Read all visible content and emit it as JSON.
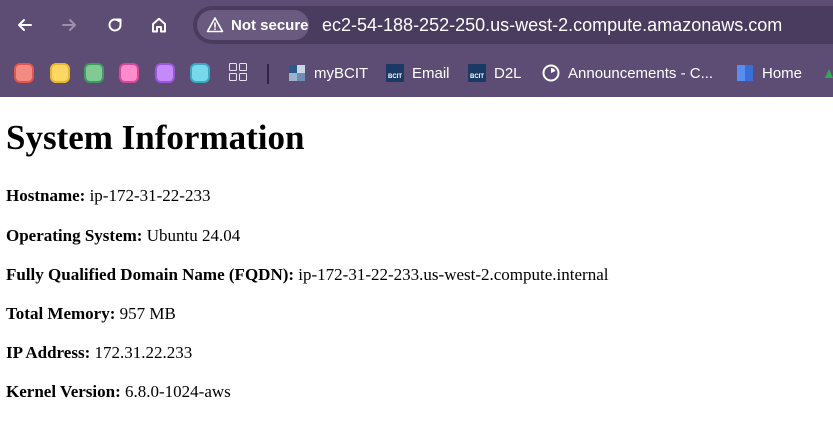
{
  "browser": {
    "security_label": "Not secure",
    "url": "ec2-54-188-252-250.us-west-2.compute.amazonaws.com",
    "color_apps": [
      {
        "fill": "#f28b82",
        "border": "#e0564f"
      },
      {
        "fill": "#fdd663",
        "border": "#e7b82e"
      },
      {
        "fill": "#81c995",
        "border": "#3f9b5f"
      },
      {
        "fill": "#ff8bcb",
        "border": "#d8489a"
      },
      {
        "fill": "#c58af9",
        "border": "#9b55e0"
      },
      {
        "fill": "#78d9ec",
        "border": "#3aa8c0"
      }
    ],
    "bookmarks": [
      {
        "label": "myBCIT",
        "icon": "mybcit-icon"
      },
      {
        "label": "Email",
        "icon": "bcit-email-icon"
      },
      {
        "label": "D2L",
        "icon": "bcit-d2l-icon"
      },
      {
        "label": "Announcements - C...",
        "icon": "announcements-icon"
      },
      {
        "label": "Home",
        "icon": "home-bookmark-icon"
      }
    ],
    "bcit_badge": "BCIT"
  },
  "page": {
    "title": "System Information",
    "fields": [
      {
        "label": "Hostname:",
        "value": "ip-172-31-22-233"
      },
      {
        "label": "Operating System:",
        "value": "Ubuntu 24.04"
      },
      {
        "label": "Fully Qualified Domain Name (FQDN):",
        "value": "ip-172-31-22-233.us-west-2.compute.internal"
      },
      {
        "label": "Total Memory:",
        "value": "957 MB"
      },
      {
        "label": "IP Address:",
        "value": "172.31.22.233"
      },
      {
        "label": "Kernel Version:",
        "value": "6.8.0-1024-aws"
      }
    ]
  }
}
